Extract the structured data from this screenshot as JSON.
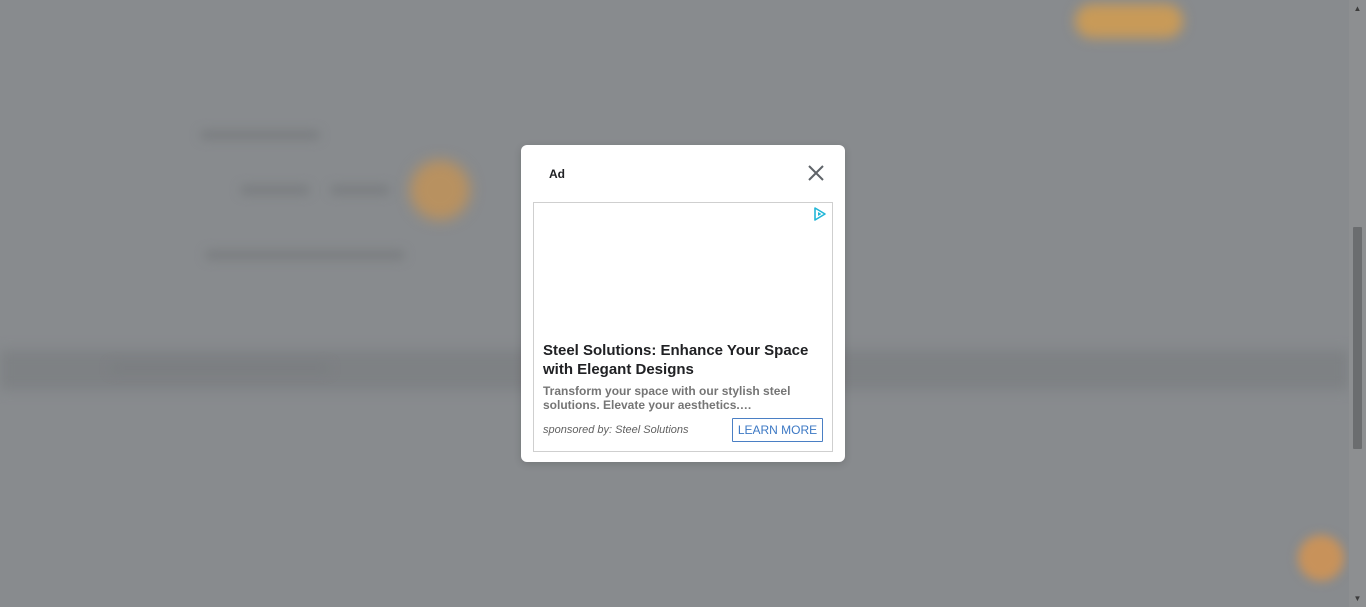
{
  "modal": {
    "label": "Ad",
    "close_icon": "close-icon"
  },
  "ad": {
    "adchoices_icon": "adchoices-icon",
    "title": "Steel Solutions: Enhance Your Space with Elegant Designs",
    "description": "Transform your space with our stylish steel solutions. Elevate your aesthetics.…",
    "sponsor": "sponsored by: Steel Solutions",
    "cta_label": "LEARN MORE",
    "accent_color": "#3c78c4"
  },
  "background": {
    "overlay_color": "#888b8e",
    "orange_color": "#c89a58"
  }
}
